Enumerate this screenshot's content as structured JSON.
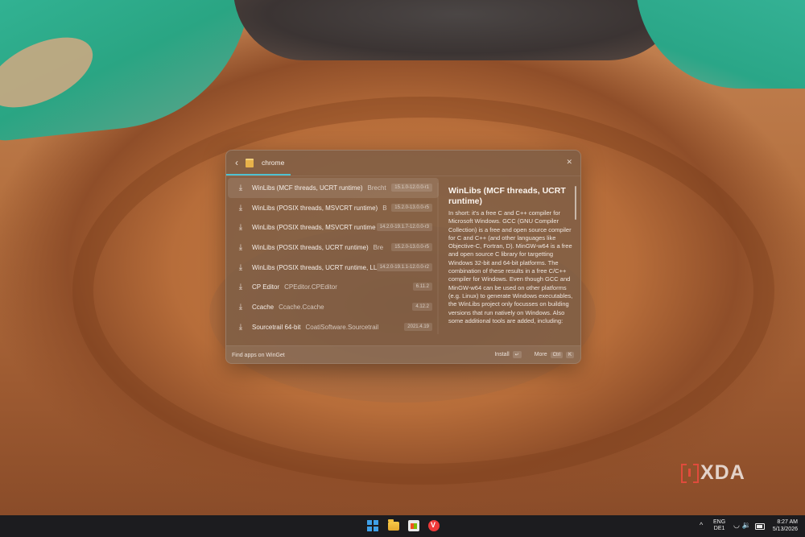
{
  "launcher": {
    "query": "chrome",
    "results": [
      {
        "title": "WinLibs (MCF threads, UCRT runtime)",
        "subtitle": "Brecht",
        "version": "15.1.0-12.0.0-r1"
      },
      {
        "title": "WinLibs (POSIX threads, MSVCRT runtime)",
        "subtitle": "B",
        "version": "15.2.0-13.0.0-r5"
      },
      {
        "title": "WinLibs (POSIX threads, MSVCRT runtime",
        "subtitle": "",
        "version": "14.2.0-19.1.7-12.0.0-r3"
      },
      {
        "title": "WinLibs (POSIX threads, UCRT runtime)",
        "subtitle": "Bre",
        "version": "15.2.0-13.0.0-r5"
      },
      {
        "title": "WinLibs (POSIX threads, UCRT runtime, LL",
        "subtitle": "",
        "version": "14.2.0-19.1.1-12.0.0-r2"
      },
      {
        "title": "CP Editor",
        "subtitle": "CPEditor.CPEditor",
        "version": "6.11.2"
      },
      {
        "title": "Ccache",
        "subtitle": "Ccache.Ccache",
        "version": "4.12.2"
      },
      {
        "title": "Sourcetrail 64-bit",
        "subtitle": "CoatiSoftware.Sourcetrail",
        "version": "2021.4.19"
      }
    ],
    "details": {
      "title": "WinLibs (MCF threads, UCRT runtime)",
      "body": "In short: it's a free C and C++ compiler for Microsoft Windows. GCC (GNU Compiler Collection) is a free and open source compiler for C and C++ (and other languages like Objective-C, Fortran, D). MinGW-w64 is a free and open source C library for targetting Windows 32-bit and 64-bit platforms. The combination of these results in a free C/C++ compiler for Windows. Even though GCC and MinGW-w64 can be used on other platforms (e.g. Linux) to generate Windows executables, the WinLibs project only focusses on building versions that run natively on Windows. Also some additional tools are added, including:"
    },
    "footer": {
      "left_label": "Find apps on WinGet",
      "install_label": "Install",
      "install_key": "↵",
      "more_label": "More",
      "more_key_1": "Ctrl",
      "more_key_2": "K"
    }
  },
  "watermark": {
    "text": "XDA"
  },
  "taskbar": {
    "tray_chevron": "^",
    "lang_line1": "ENG",
    "lang_line2": "DE1",
    "time": "8:27 AM",
    "date": "5/13/2026"
  },
  "icons": {
    "back": "back-arrow-icon",
    "plugin": "folder-icon",
    "close": "close-icon",
    "download": "download-icon",
    "enter": "enter-key-icon"
  }
}
